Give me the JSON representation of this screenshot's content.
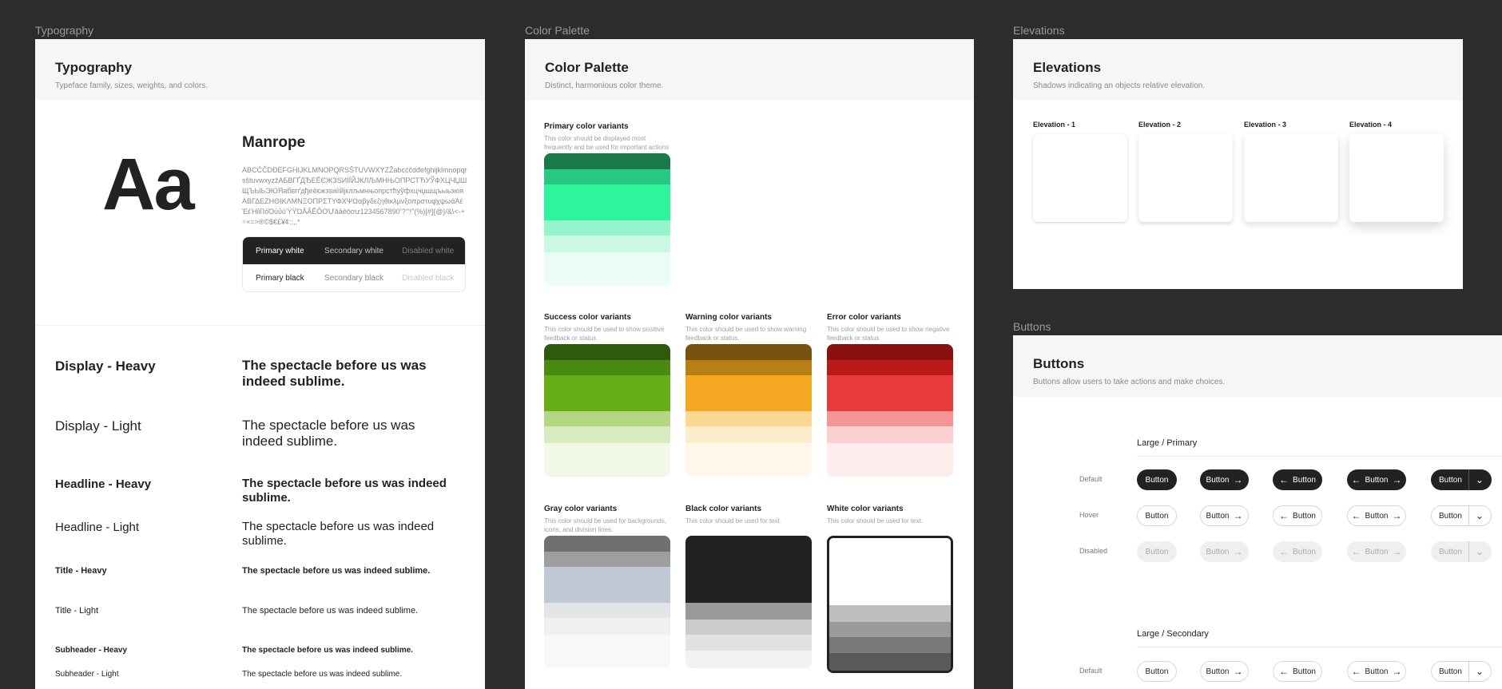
{
  "labels": {
    "typography": "Typography",
    "color_palette": "Color Palette",
    "elevations": "Elevations",
    "buttons": "Buttons"
  },
  "typography": {
    "title": "Typography",
    "subtitle": "Typeface family, sizes, weights, and colors.",
    "sample": "Aa",
    "font_name": "Manrope",
    "glyphs": "ABCĆČDĐEFGHIJKLMNOPQRSŠTUVWXYZŽabcćčdđefghijklmnopqrsštuvwxyzžАБВГҐДЂЕЁЄЖЗЅИІЇЙЈКЛЉМНЊОПРСТЋУЎФХЦЧЏШЩЪЫЬЭЮЯабвгґдђеёєжзѕиіїйјклљмнњопрстћуўфхцчџшщъыьэюяΑΒΓΔΕΖΗΘΙΚΛΜΝΞΟΠΡΣΤΥΦΧΨΩαβγδεζηθικλμνξοπρστυφχψωάΆέΈέΉίϊΐΊόΌύΰϋΎΫΏĂÂÊÔƠƯăâêôơư1234567890‘?’“!”(%)[#]{@}/&\\<-+÷×=>®©$€£¥¢:;,.*",
    "swatches": {
      "dark": [
        "Primary white",
        "Secondary white",
        "Disabled white"
      ],
      "light": [
        "Primary black",
        "Secondary black",
        "Disabled black"
      ]
    },
    "styles": [
      {
        "name": "Display - Heavy",
        "sample": "The spectacle before us was indeed sublime."
      },
      {
        "name": "Display - Light",
        "sample": "The spectacle before us was indeed sublime."
      },
      {
        "name": "Headline - Heavy",
        "sample": "The spectacle before us was indeed sublime."
      },
      {
        "name": "Headline - Light",
        "sample": "The spectacle before us was indeed sublime."
      },
      {
        "name": "Title - Heavy",
        "sample": "The spectacle before us was indeed sublime."
      },
      {
        "name": "Title - Light",
        "sample": "The spectacle before us was indeed sublime."
      },
      {
        "name": "Subheader - Heavy",
        "sample": "The spectacle before us was indeed sublime."
      },
      {
        "name": "Subheader - Light",
        "sample": "The spectacle before us was indeed sublime."
      }
    ]
  },
  "palette": {
    "title": "Color Palette",
    "subtitle": "Distinct, harmonious color theme.",
    "groups": [
      {
        "title": "Primary color variants",
        "desc": "This color should be displayed most frequently and be used for important actions",
        "colors": [
          "#1a7a4c",
          "#27c784",
          "#2ef59b",
          "#94f5cb",
          "#c9f9e3",
          "#eafdf4"
        ]
      },
      {
        "title": "Success color variants",
        "desc": "This color should be used to show positive feedback or status",
        "colors": [
          "#2f5a0a",
          "#4a8a12",
          "#67ad16",
          "#b3d683",
          "#d9ebc0",
          "#f1f8e8"
        ]
      },
      {
        "title": "Warning color variants",
        "desc": "This color should be used to show warning feedback or status.",
        "colors": [
          "#7a5210",
          "#b78016",
          "#f4a821",
          "#fbd995",
          "#fdeccb",
          "#fef7eb"
        ]
      },
      {
        "title": "Error color variants",
        "desc": "This color should be used to show negative feedback or status",
        "colors": [
          "#8b1111",
          "#b81a1a",
          "#e83c3c",
          "#f69595",
          "#fad0d0",
          "#fdecec"
        ]
      },
      {
        "title": "Gray color variants",
        "desc": "This color should be used for backgrounds, icons, and division lines.",
        "colors": [
          "#707070",
          "#9e9e9e",
          "#bfc9d6",
          "#e2e4e7",
          "#eef0f2",
          "#f7f8f9"
        ]
      },
      {
        "title": "Black color variants",
        "desc": "This color should be used for text.",
        "colors": [
          "#222222",
          "#222222",
          "#9a9a9a",
          "#cccccc",
          "#e2e2e2",
          "#f2f2f2"
        ]
      },
      {
        "title": "White color variants",
        "desc": "This color should be used for text.",
        "colors": [
          "#ffffff",
          "#ffffff",
          "#bdbdbd",
          "#9a9a9a",
          "#7a7a7a",
          "#5a5a5a"
        ]
      }
    ]
  },
  "elevations": {
    "title": "Elevations",
    "subtitle": "Shadows indicating an objects relative elevation.",
    "items": [
      "Elevation - 1",
      "Elevation - 2",
      "Elevation - 3",
      "Elevation - 4"
    ]
  },
  "buttons": {
    "title": "Buttons",
    "subtitle": "Buttons allow users to take actions and make choices.",
    "section_primary": "Large / Primary",
    "section_secondary": "Large / Secondary",
    "states": [
      "Default",
      "Hover",
      "Disabled",
      "Default"
    ],
    "label": "Button"
  }
}
